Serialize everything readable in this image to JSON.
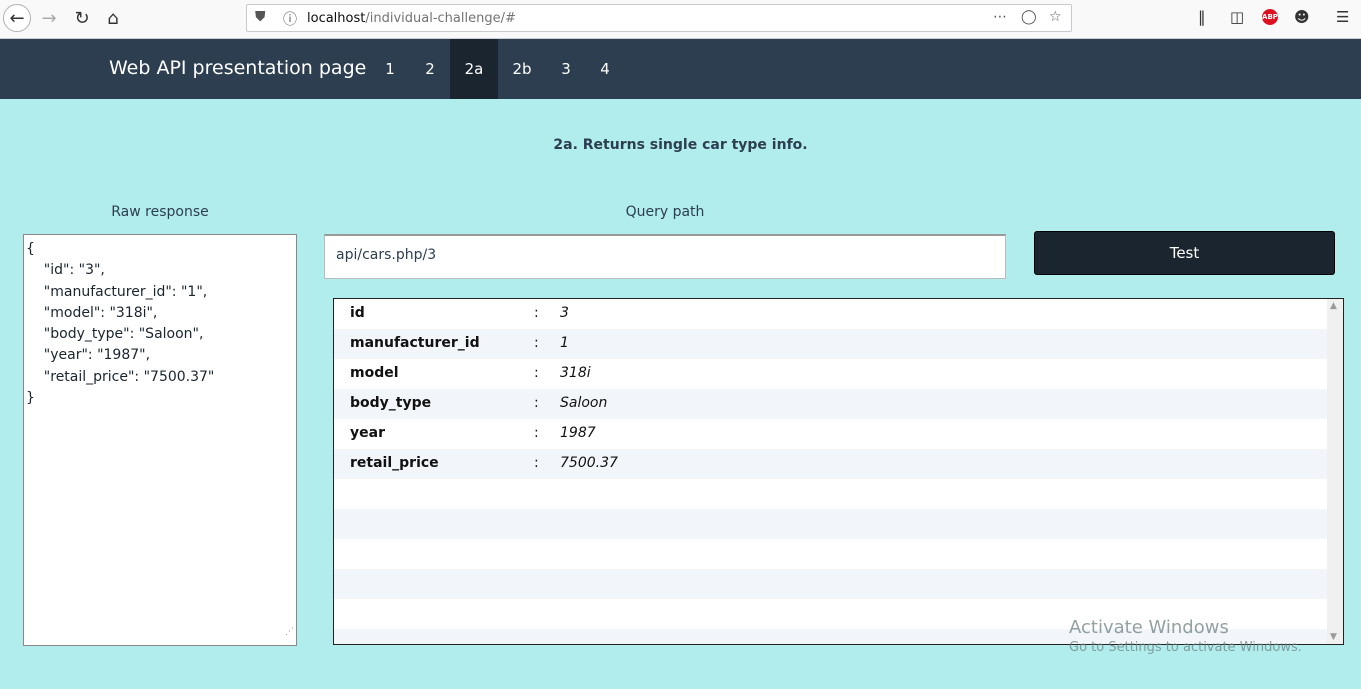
{
  "browser": {
    "url_host": "localhost",
    "url_path": "/individual-challenge/#"
  },
  "navbar": {
    "brand": "Web API presentation page",
    "items": [
      {
        "label": "1"
      },
      {
        "label": "2"
      },
      {
        "label": "2a"
      },
      {
        "label": "2b"
      },
      {
        "label": "3"
      },
      {
        "label": "4"
      }
    ],
    "active": "2a"
  },
  "main": {
    "heading": "2a. Returns single car type info.",
    "raw_label": "Raw response",
    "query_label": "Query path",
    "raw_response": "{\n    \"id\": \"3\",\n    \"manufacturer_id\": \"1\",\n    \"model\": \"318i\",\n    \"body_type\": \"Saloon\",\n    \"year\": \"1987\",\n    \"retail_price\": \"7500.37\"\n}",
    "query_value": "api/cars.php/3",
    "test_label": "Test",
    "separator": ":",
    "rows": [
      {
        "key": "id",
        "value": "3"
      },
      {
        "key": "manufacturer_id",
        "value": "1"
      },
      {
        "key": "model",
        "value": "318i"
      },
      {
        "key": "body_type",
        "value": "Saloon"
      },
      {
        "key": "year",
        "value": "1987"
      },
      {
        "key": "retail_price",
        "value": "7500.37"
      }
    ]
  },
  "watermark": {
    "line1": "Activate Windows",
    "line2": "Go to Settings to activate Windows."
  }
}
